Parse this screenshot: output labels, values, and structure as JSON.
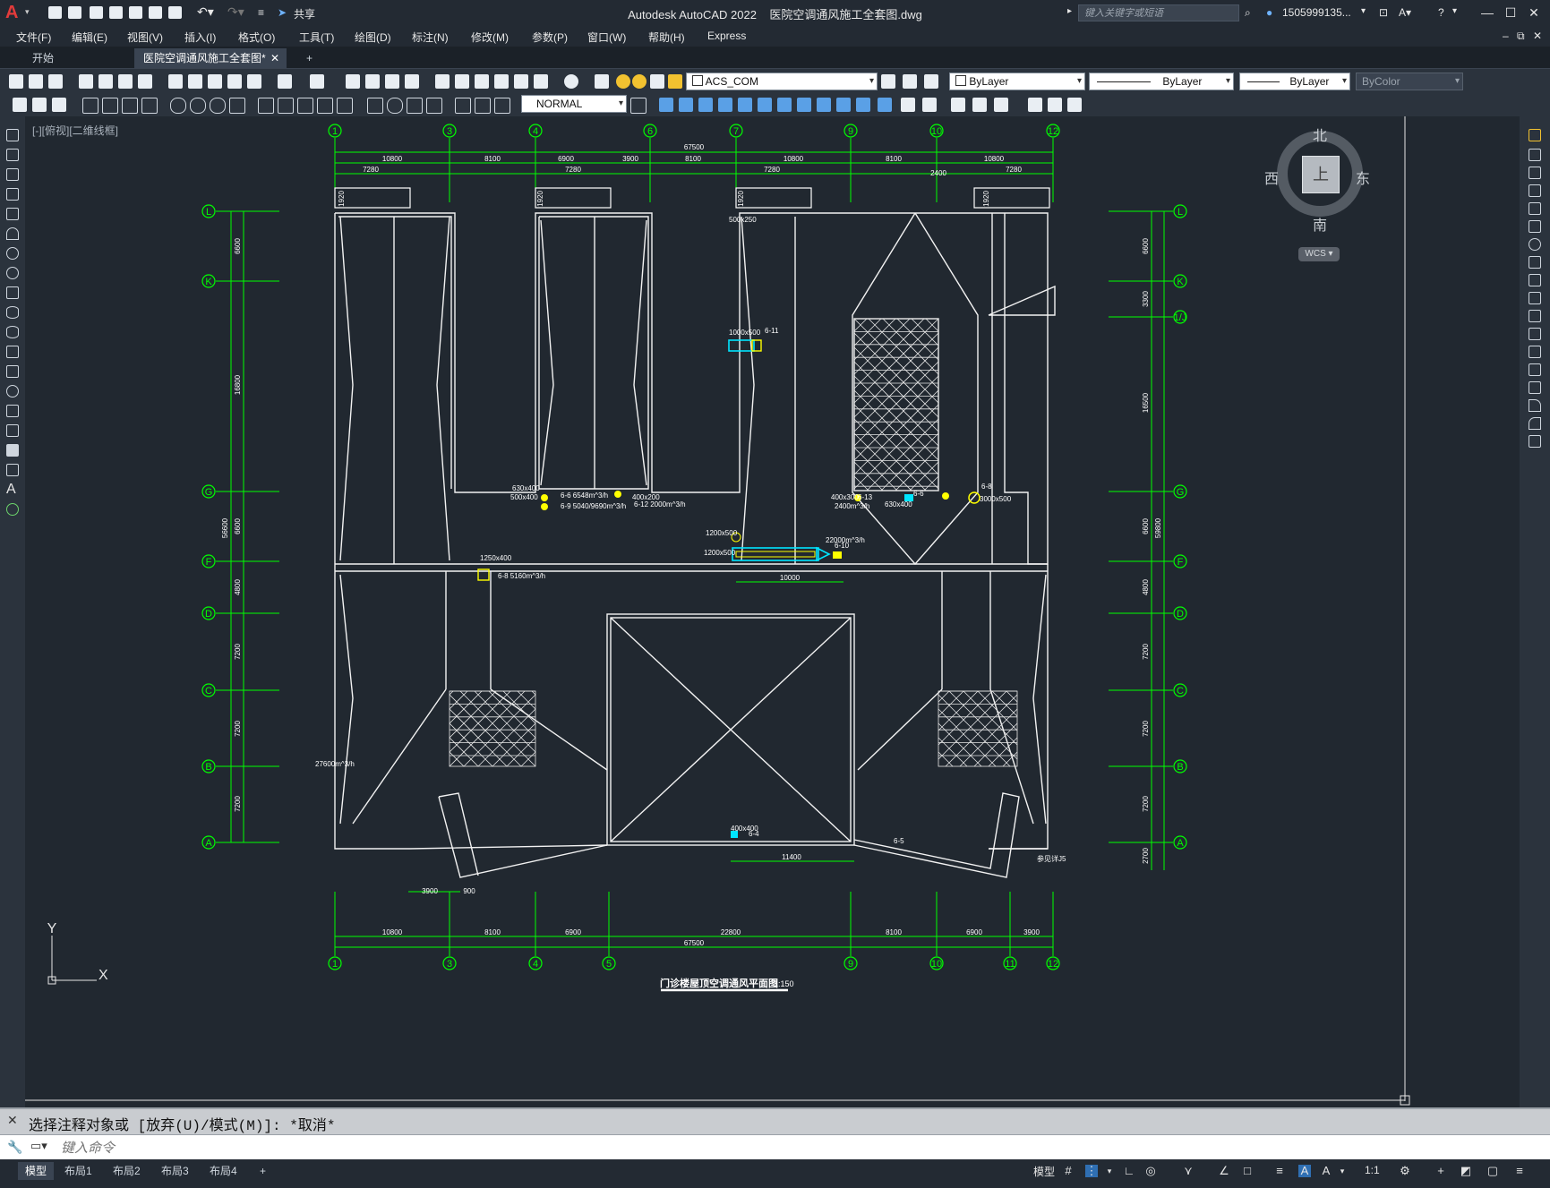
{
  "app": {
    "title": "Autodesk AutoCAD 2022",
    "document": "医院空调通风施工全套图.dwg",
    "share_label": "共享"
  },
  "header": {
    "search_placeholder": "键入关键字或短语",
    "user": "1505999135...",
    "help": "?"
  },
  "menu": [
    "文件(F)",
    "编辑(E)",
    "视图(V)",
    "插入(I)",
    "格式(O)",
    "工具(T)",
    "绘图(D)",
    "标注(N)",
    "修改(M)",
    "参数(P)",
    "窗口(W)",
    "帮助(H)",
    "Express"
  ],
  "tabs": [
    {
      "label": "开始"
    },
    {
      "label": "医院空调通风施工全套图*"
    }
  ],
  "toolbar": {
    "layer": "ACS_COM",
    "color": "ByLayer",
    "linetype": "ByLayer",
    "lineweight": "ByLayer",
    "plotstyle": "ByColor",
    "text_style": "NORMAL"
  },
  "viewport_label": "[-][俯视][二维线框]",
  "viewcube": {
    "north": "北",
    "south": "南",
    "east": "东",
    "west": "西",
    "face": "上",
    "wcs": "WCS"
  },
  "drawing": {
    "title": "门诊楼屋顶空调通风平面图",
    "scale": "1:150",
    "top_axes": [
      "1",
      "3",
      "4",
      "6",
      "7",
      "9",
      "10",
      "12"
    ],
    "bottom_axes": [
      "1",
      "3",
      "4",
      "5",
      "9",
      "10",
      "11",
      "12"
    ],
    "side_axes": [
      "L",
      "K",
      "G",
      "F",
      "D",
      "C",
      "B",
      "A"
    ],
    "right_axes_extra": "1/J",
    "dim_total": "67500",
    "top_dims": [
      "10800",
      "8100",
      "6900",
      "3900",
      "8100",
      "10800",
      "8100",
      "10800"
    ],
    "sub_dims": [
      "7280",
      "7280",
      "7280",
      "7280",
      "2400"
    ],
    "bottom_dims": [
      "10800",
      "8100",
      "6900",
      "22800",
      "8100",
      "6900",
      "3900"
    ],
    "left_dims": [
      "6600",
      "16800",
      "56600",
      "6600",
      "4800",
      "7200",
      "7200",
      "7200"
    ],
    "right_dims": [
      "6600",
      "3300",
      "16500",
      "59800",
      "6600",
      "4800",
      "7200",
      "7200",
      "7200",
      "2700"
    ],
    "inner_dims": [
      "10000",
      "11400",
      "3900",
      "900",
      "1920"
    ],
    "annotations": [
      "630x400",
      "500x400",
      "6-6 6548m^3/h",
      "6-9 5040/9690m^3/h",
      "400x200",
      "6-12 2000m^3/h",
      "1000x500",
      "6-11",
      "1200x500",
      "1200x500",
      "22000m^3/h",
      "6-10",
      "400x300",
      "6-13",
      "2400m^3/h",
      "630x400",
      "6-6",
      "6-8",
      "3000x500",
      "400x400",
      "6-4",
      "6-5",
      "1250x400",
      "6-8 5160m^3/h",
      "27600m^3/h",
      "500x250",
      "参见详J5"
    ]
  },
  "command": {
    "history": "选择注释对象或 [放弃(U)/模式(M)]: *取消*",
    "placeholder": "键入命令"
  },
  "status": {
    "layouts": [
      "模型",
      "布局1",
      "布局2",
      "布局3",
      "布局4"
    ],
    "model_label": "模型",
    "scale": "1:1"
  },
  "colors": {
    "axis": "#00ff00",
    "wall": "#ffffff",
    "duct": "#00e5ff",
    "equipment": "#ffff00",
    "background": "#212830"
  }
}
